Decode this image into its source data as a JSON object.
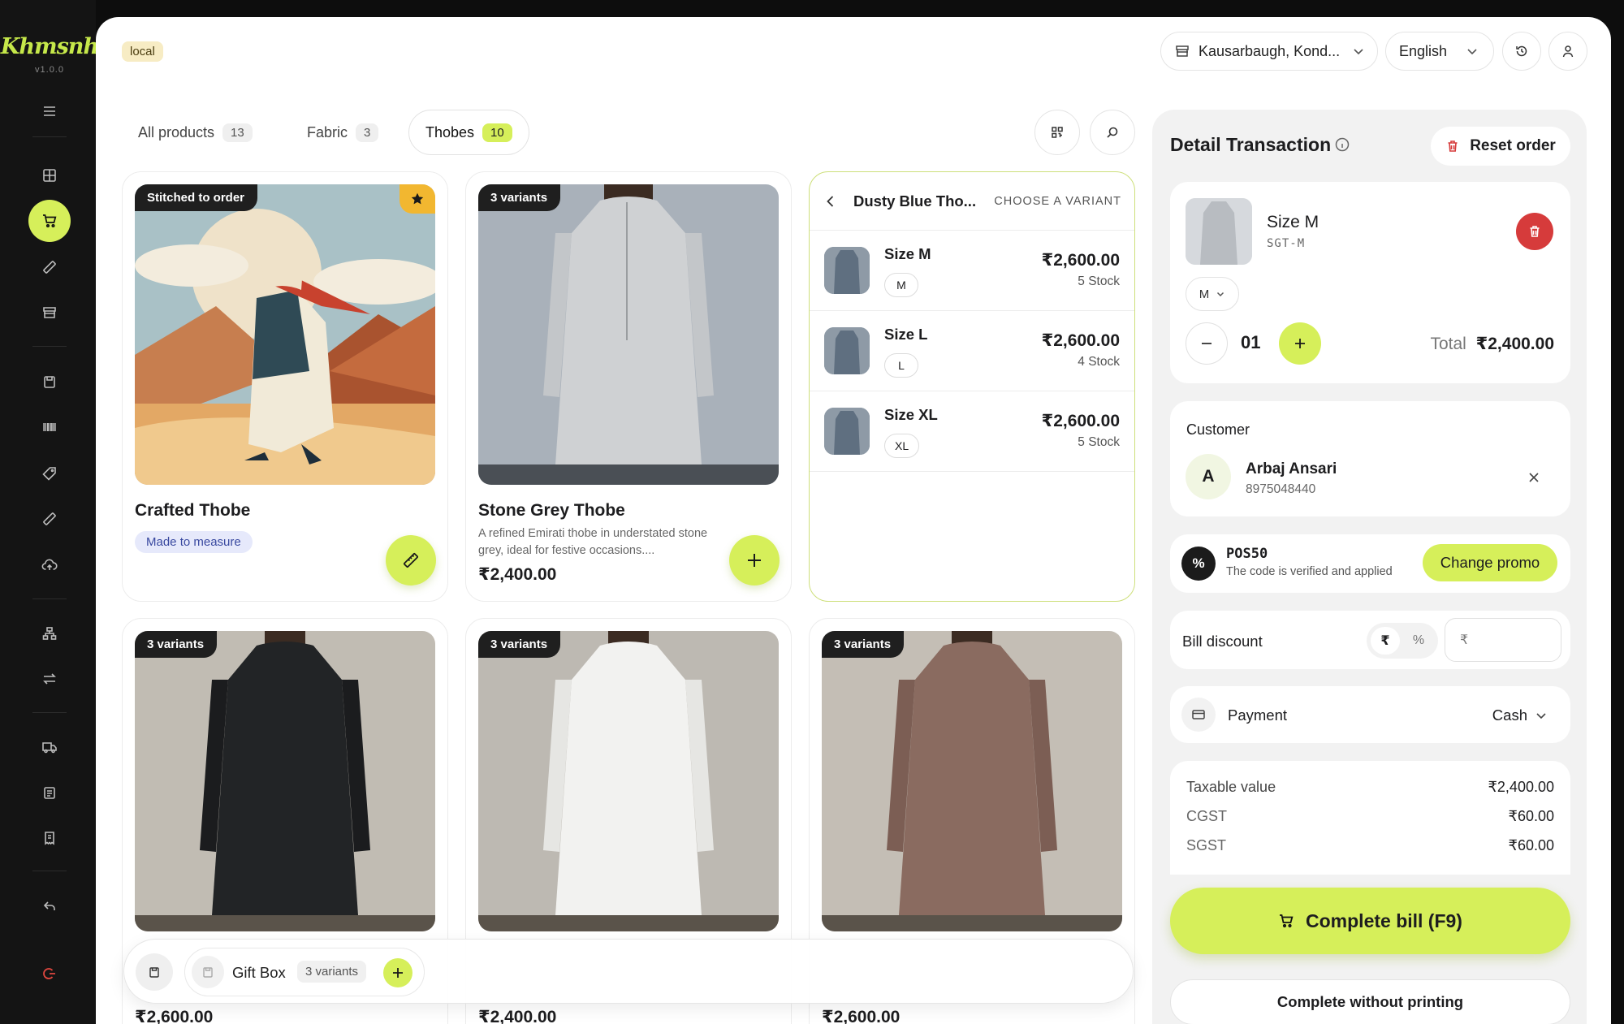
{
  "app": {
    "logo": "Khmsnh",
    "version": "v1.0.0"
  },
  "header": {
    "env_badge": "local",
    "location": "Kausarbaugh, Kond...",
    "language": "English"
  },
  "tabs": [
    {
      "label": "All products",
      "count": "13"
    },
    {
      "label": "Fabric",
      "count": "3"
    },
    {
      "label": "Thobes",
      "count": "10"
    }
  ],
  "products": [
    {
      "tag": "Stitched to order",
      "name": "Crafted Thobe",
      "badge": "Made to measure"
    },
    {
      "tag": "3 variants",
      "name": "Stone Grey Thobe",
      "description": "A refined Emirati thobe in understated stone grey, ideal for festive occasions....",
      "price": "₹2,400.00"
    },
    {
      "tag": "3 variants",
      "price": "₹2,600.00"
    },
    {
      "tag": "3 variants",
      "price": "₹2,400.00"
    },
    {
      "tag": "3 variants",
      "price": "₹2,600.00"
    }
  ],
  "variant_panel": {
    "title": "Dusty Blue Tho...",
    "hint": "CHOOSE A VARIANT",
    "variants": [
      {
        "name": "Size M",
        "chip": "M",
        "price": "₹2,600.00",
        "stock": "5 Stock"
      },
      {
        "name": "Size L",
        "chip": "L",
        "price": "₹2,600.00",
        "stock": "4 Stock"
      },
      {
        "name": "Size XL",
        "chip": "XL",
        "price": "₹2,600.00",
        "stock": "5 Stock"
      }
    ]
  },
  "floatbar": {
    "item": "Gift Box",
    "variants": "3 variants"
  },
  "transaction": {
    "title": "Detail Transaction",
    "reset": "Reset order",
    "line": {
      "name": "Size M",
      "sku": "SGT-M",
      "size": "M",
      "qty": "01",
      "total_label": "Total",
      "total": "₹2,400.00"
    },
    "customer": {
      "label": "Customer",
      "initial": "A",
      "name": "Arbaj Ansari",
      "phone": "8975048440"
    },
    "promo": {
      "icon": "%",
      "code": "POS50",
      "message": "The code is verified and applied",
      "button": "Change promo"
    },
    "bill_discount": {
      "label": "Bill discount",
      "opt_currency": "₹",
      "opt_percent": "%",
      "placeholder": "₹"
    },
    "payment": {
      "label": "Payment",
      "method": "Cash"
    },
    "taxes": [
      {
        "k": "Taxable value",
        "v": "₹2,400.00"
      },
      {
        "k": "CGST",
        "v": "₹60.00"
      },
      {
        "k": "SGST",
        "v": "₹60.00"
      }
    ],
    "complete": "Complete bill (F9)",
    "complete_noprint": "Complete without printing"
  },
  "colors": {
    "accent": "#d6ef5a",
    "sidebar": "#141414",
    "danger": "#d63b3b"
  }
}
